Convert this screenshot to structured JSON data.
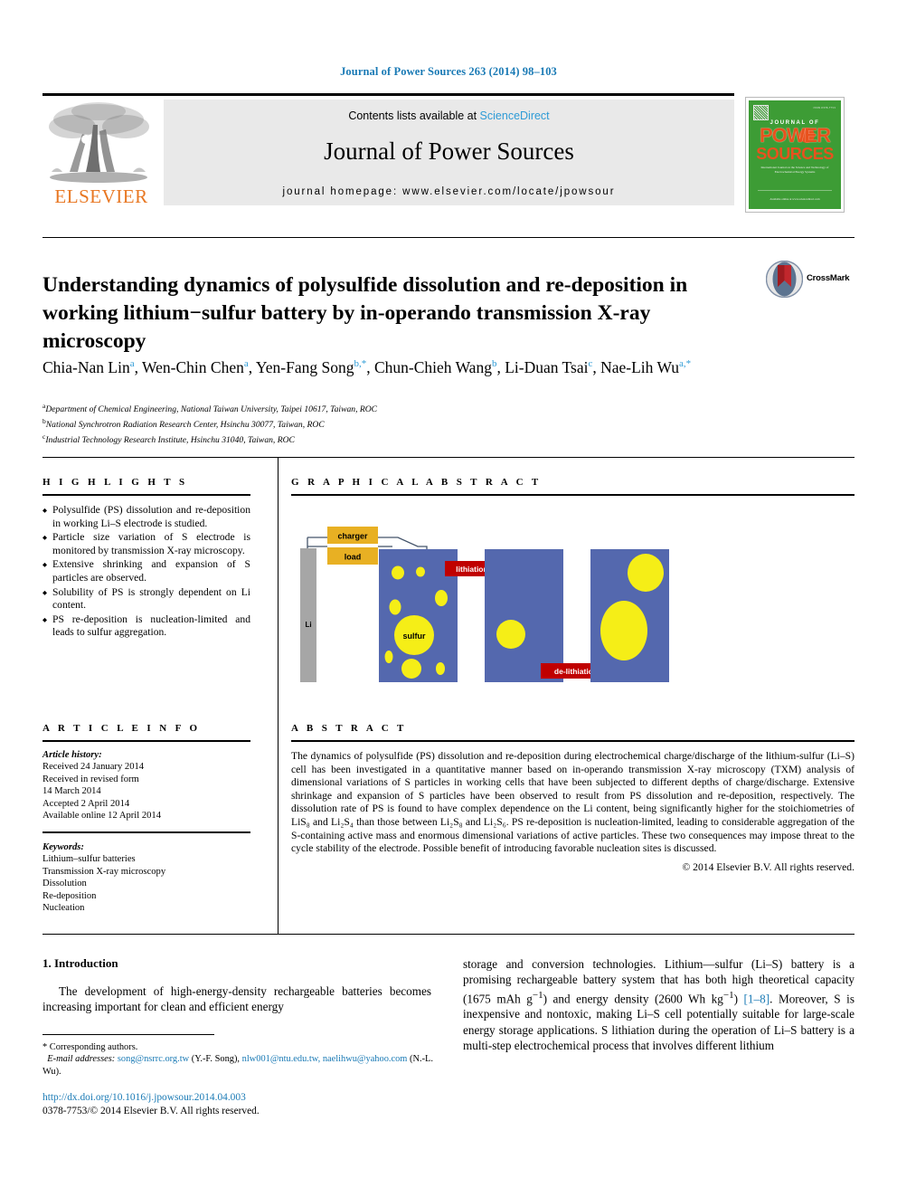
{
  "running_head": "Journal of Power Sources 263 (2014) 98–103",
  "masthead": {
    "contents_prefix": "Contents lists available at ",
    "sciencedirect": "ScienceDirect",
    "journal_name": "Journal of Power Sources",
    "homepage": "journal homepage: www.elsevier.com/locate/jpowsour",
    "publisher": "ELSEVIER",
    "cover": {
      "journal_of": "JOURNAL OF",
      "power": "POWER",
      "sources": "SOURCES",
      "subtitle": "International Journal on the Science and Technology of Electrochemical Energy Systems",
      "footer": "Available online at www.sciencedirect.com"
    }
  },
  "article": {
    "title": "Understanding dynamics of polysulfide dissolution and re-deposition in working lithium−sulfur battery by in-operando transmission X-ray microscopy",
    "crossmark_label": "CrossMark",
    "authors": [
      {
        "name": "Chia-Nan Lin",
        "marks": "a",
        "sep": ", "
      },
      {
        "name": "Wen-Chin Chen",
        "marks": "a",
        "sep": ", "
      },
      {
        "name": "Yen-Fang Song",
        "marks": "b,*",
        "sep": ", "
      },
      {
        "name": "Chun-Chieh Wang",
        "marks": "b",
        "sep": ", "
      },
      {
        "name": "Li-Duan Tsai",
        "marks": "c",
        "sep": ", "
      },
      {
        "name": "Nae-Lih Wu",
        "marks": "a,*",
        "sep": ""
      }
    ],
    "affiliations": [
      {
        "mark": "a",
        "text": "Department of Chemical Engineering, National Taiwan University, Taipei 10617, Taiwan, ROC"
      },
      {
        "mark": "b",
        "text": "National Synchrotron Radiation Research Center, Hsinchu 30077, Taiwan, ROC"
      },
      {
        "mark": "c",
        "text": "Industrial Technology Research Institute, Hsinchu 31040, Taiwan, ROC"
      }
    ]
  },
  "highlights": {
    "heading": "H I G H L I G H T S",
    "items": [
      "Polysulfide (PS) dissolution and re-deposition in working Li–S electrode is studied.",
      "Particle size variation of S electrode is monitored by transmission X-ray microscopy.",
      "Extensive shrinking and expansion of S particles are observed.",
      "Solubility of PS is strongly dependent on Li content.",
      "PS re-deposition is nucleation-limited and leads to sulfur aggregation."
    ]
  },
  "graphical_abstract": {
    "heading": "G R A P H I C A L   A B S T R A C T",
    "labels": {
      "charger": "charger",
      "load": "load",
      "li": "Li",
      "sulfur": "sulfur",
      "lithiation": "lithiation",
      "delithiation": "de-lithiation"
    },
    "colors": {
      "electrode": "#5468ae",
      "sulfur": "#f5ee17",
      "li_metal": "#a6a6a6",
      "box": "#e8b023",
      "arrow": "#c00000",
      "wire": "#44546a"
    }
  },
  "article_info": {
    "heading": "A R T I C L E   I N F O",
    "history_label": "Article history:",
    "history": [
      "Received 24 January 2014",
      "Received in revised form",
      "14 March 2014",
      "Accepted 2 April 2014",
      "Available online 12 April 2014"
    ],
    "keywords_label": "Keywords:",
    "keywords": [
      "Lithium–sulfur batteries",
      "Transmission X-ray microscopy",
      "Dissolution",
      "Re-deposition",
      "Nucleation"
    ]
  },
  "abstract": {
    "heading": "A B S T R A C T",
    "text": "The dynamics of polysulfide (PS) dissolution and re-deposition during electrochemical charge/discharge of the lithium-sulfur (Li–S) cell has been investigated in a quantitative manner based on in-operando transmission X-ray microscopy (TXM) analysis of dimensional variations of S particles in working cells that have been subjected to different depths of charge/discharge. Extensive shrinkage and expansion of S particles have been observed to result from PS dissolution and re-deposition, respectively. The dissolution rate of PS is found to have complex dependence on the Li content, being significantly higher for the stoichiometries of LiS₈ and Li₂S₄ than those between Li₂S₈ and Li₂S₆. PS re-deposition is nucleation-limited, leading to considerable aggregation of the S-containing active mass and enormous dimensional variations of active particles. These two consequences may impose threat to the cycle stability of the electrode. Possible benefit of introducing favorable nucleation sites is discussed.",
    "copyright": "© 2014 Elsevier B.V. All rights reserved."
  },
  "body": {
    "section_title": "1. Introduction",
    "col1_p1": "The development of high-energy-density rechargeable batteries becomes increasing important for clean and efficient energy",
    "col2_pre": "storage and conversion technologies. Lithium—sulfur (Li–S) battery is a promising rechargeable battery system that has both high theoretical capacity (1675 mAh g",
    "col2_sup1": "−1",
    "col2_mid": ") and energy density (2600 Wh kg",
    "col2_sup2": "−1",
    "col2_mid2": ") ",
    "col2_ref": "[1–8]",
    "col2_post": ". Moreover, S is inexpensive and nontoxic, making Li–S cell potentially suitable for large-scale energy storage applications. S lithiation during the operation of Li–S battery is a multi-step electrochemical process that involves different lithium"
  },
  "footer": {
    "corresponding": "* Corresponding authors.",
    "email_label": "E-mail addresses:",
    "email1": "song@nsrrc.org.tw",
    "email1_owner": "(Y.-F. Song),",
    "email2": "nlw001@ntu.edu.tw,",
    "email3": "naelihwu@yahoo.com",
    "email3_owner": "(N.-L. Wu).",
    "doi": "http://dx.doi.org/10.1016/j.jpowsour.2014.04.003",
    "issn_line": "0378-7753/© 2014 Elsevier B.V. All rights reserved."
  }
}
